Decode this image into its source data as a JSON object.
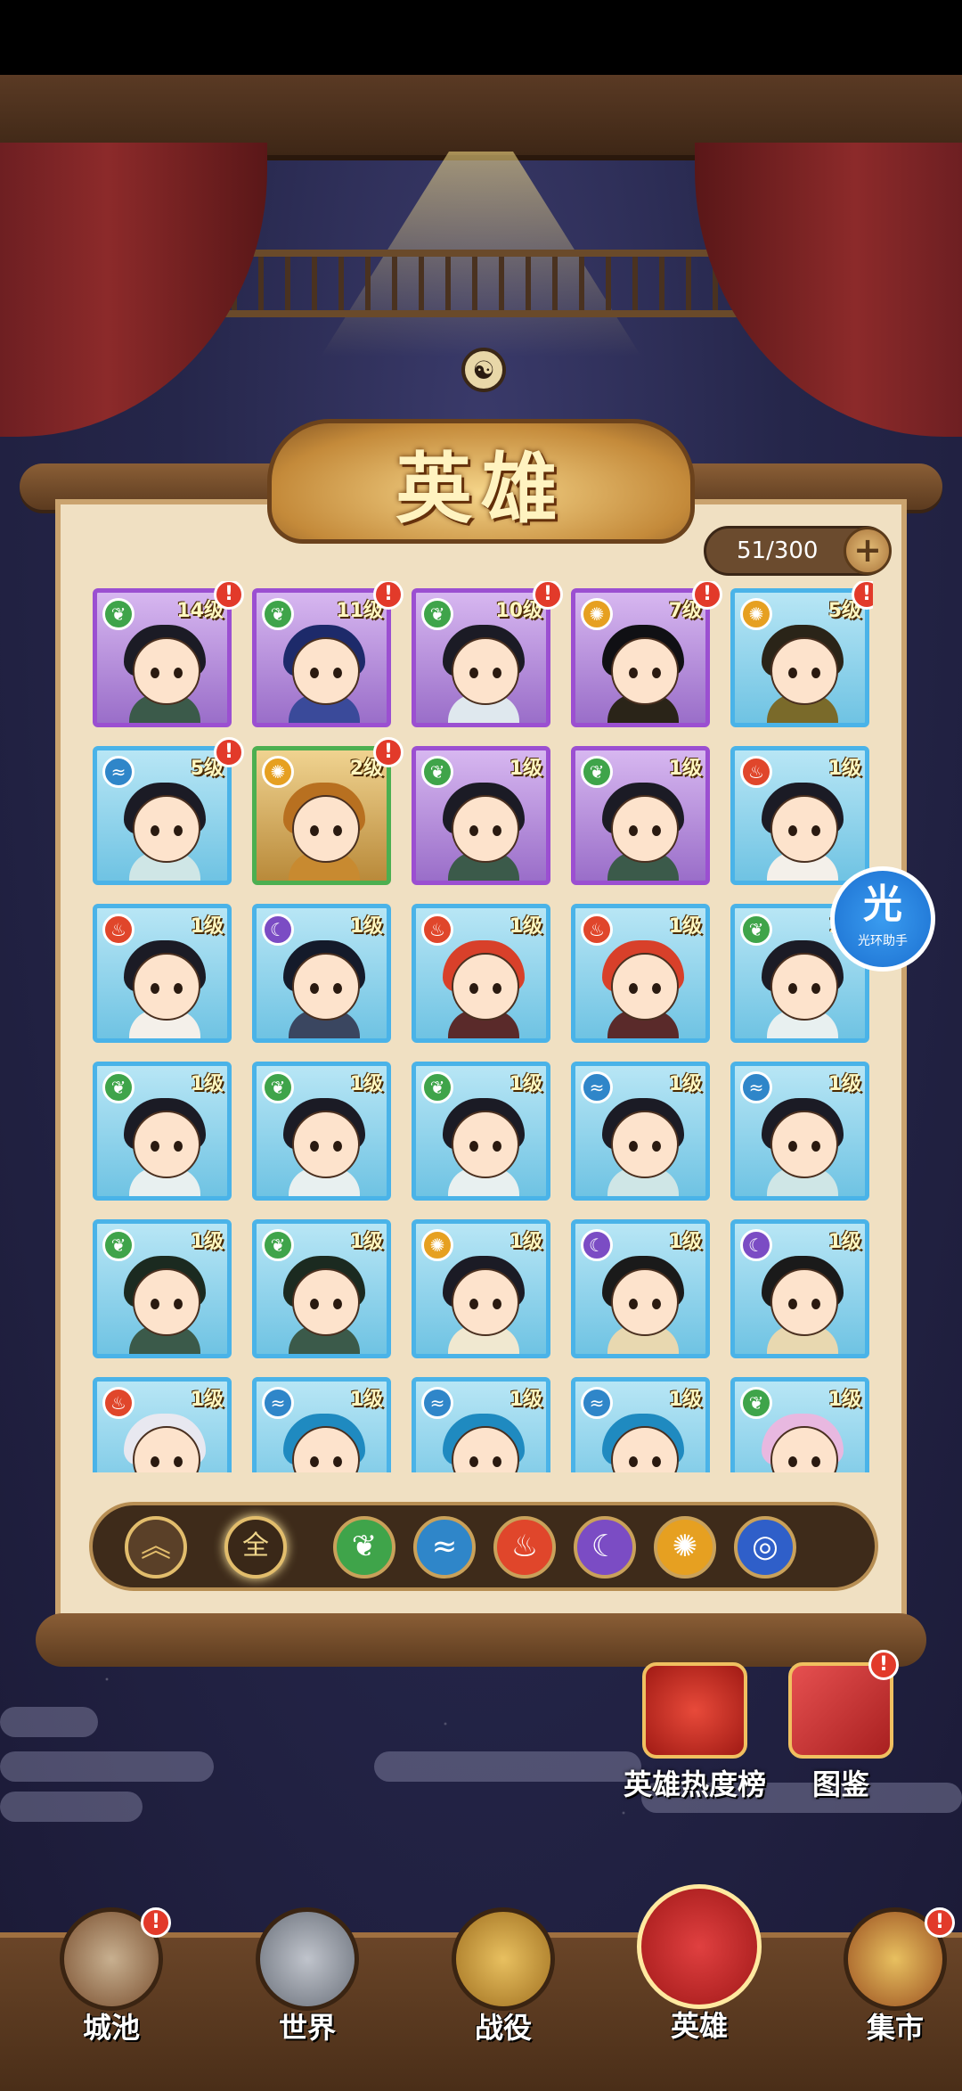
{
  "title": "英雄",
  "hero_count": "51/300",
  "helper": {
    "big": "光",
    "small": "光环助手"
  },
  "element_colors": {
    "wood": "#3fa44a",
    "water": "#2f86c9",
    "fire": "#e0462b",
    "moon": "#7b4cc4",
    "light": "#e6a021",
    "storm": "#2f5fc9"
  },
  "heroes": [
    {
      "level": "14级",
      "element": "wood",
      "rarity": "purple",
      "alert": true,
      "hair": "#1b1b25",
      "outfit": "#3b5a4a"
    },
    {
      "level": "11级",
      "element": "wood",
      "rarity": "purple",
      "alert": true,
      "hair": "#1d2a6a",
      "outfit": "#3a4a9a"
    },
    {
      "level": "10级",
      "element": "wood",
      "rarity": "purple",
      "alert": true,
      "hair": "#1b1b25",
      "outfit": "#dfe8ee"
    },
    {
      "level": "7级",
      "element": "light",
      "rarity": "purple",
      "alert": true,
      "hair": "#101014",
      "outfit": "#2a2418"
    },
    {
      "level": "5级",
      "element": "light",
      "rarity": "blue",
      "alert": true,
      "hair": "#2a2418",
      "outfit": "#7a6a2a"
    },
    {
      "level": "5级",
      "element": "water",
      "rarity": "blue",
      "alert": true,
      "hair": "#1b1b25",
      "outfit": "#cfe6e6"
    },
    {
      "level": "2级",
      "element": "light",
      "rarity": "green",
      "alert": true,
      "hair": "#b87020",
      "outfit": "#c88a30"
    },
    {
      "level": "1级",
      "element": "wood",
      "rarity": "purple",
      "alert": false,
      "hair": "#1b1b25",
      "outfit": "#3b5a4a"
    },
    {
      "level": "1级",
      "element": "wood",
      "rarity": "purple",
      "alert": false,
      "hair": "#1b1b25",
      "outfit": "#3b5a4a"
    },
    {
      "level": "1级",
      "element": "fire",
      "rarity": "blue",
      "alert": false,
      "hair": "#1b1b25",
      "outfit": "#f4f0ea"
    },
    {
      "level": "1级",
      "element": "fire",
      "rarity": "blue",
      "alert": false,
      "hair": "#1b1b25",
      "outfit": "#f4f0ea"
    },
    {
      "level": "1级",
      "element": "moon",
      "rarity": "blue",
      "alert": false,
      "hair": "#141a2a",
      "outfit": "#3a4660"
    },
    {
      "level": "1级",
      "element": "fire",
      "rarity": "blue",
      "alert": false,
      "hair": "#d8402a",
      "outfit": "#5a2a2a"
    },
    {
      "level": "1级",
      "element": "fire",
      "rarity": "blue",
      "alert": false,
      "hair": "#d8402a",
      "outfit": "#5a2a2a"
    },
    {
      "level": "1级",
      "element": "wood",
      "rarity": "blue",
      "alert": false,
      "hair": "#1b1b25",
      "outfit": "#e8f0f0"
    },
    {
      "level": "1级",
      "element": "wood",
      "rarity": "blue",
      "alert": false,
      "hair": "#1b1b25",
      "outfit": "#e8f0f0"
    },
    {
      "level": "1级",
      "element": "wood",
      "rarity": "blue",
      "alert": false,
      "hair": "#1b1b25",
      "outfit": "#e8f0f0"
    },
    {
      "level": "1级",
      "element": "wood",
      "rarity": "blue",
      "alert": false,
      "hair": "#1b1b25",
      "outfit": "#e8f0f0"
    },
    {
      "level": "1级",
      "element": "water",
      "rarity": "blue",
      "alert": false,
      "hair": "#1b1b25",
      "outfit": "#cfe6e6"
    },
    {
      "level": "1级",
      "element": "water",
      "rarity": "blue",
      "alert": false,
      "hair": "#1b1b25",
      "outfit": "#cfe6e6"
    },
    {
      "level": "1级",
      "element": "wood",
      "rarity": "blue",
      "alert": false,
      "hair": "#1b2a20",
      "outfit": "#3b5a4a"
    },
    {
      "level": "1级",
      "element": "wood",
      "rarity": "blue",
      "alert": false,
      "hair": "#1b2a20",
      "outfit": "#3b5a4a"
    },
    {
      "level": "1级",
      "element": "light",
      "rarity": "blue",
      "alert": false,
      "hair": "#1b1b25",
      "outfit": "#f0e8d0"
    },
    {
      "level": "1级",
      "element": "moon",
      "rarity": "blue",
      "alert": false,
      "hair": "#1a1a1a",
      "outfit": "#e8d8b0"
    },
    {
      "level": "1级",
      "element": "moon",
      "rarity": "blue",
      "alert": false,
      "hair": "#1a1a1a",
      "outfit": "#e8d8b0"
    },
    {
      "level": "1级",
      "element": "fire",
      "rarity": "blue",
      "alert": false,
      "hair": "#e8e8f0",
      "outfit": "#2a2a3a"
    },
    {
      "level": "1级",
      "element": "water",
      "rarity": "blue",
      "alert": false,
      "hair": "#1f8ac0",
      "outfit": "#1f8ac0"
    },
    {
      "level": "1级",
      "element": "water",
      "rarity": "blue",
      "alert": false,
      "hair": "#1f8ac0",
      "outfit": "#1f8ac0"
    },
    {
      "level": "1级",
      "element": "water",
      "rarity": "blue",
      "alert": false,
      "hair": "#1f8ac0",
      "outfit": "#1f8ac0"
    },
    {
      "level": "1级",
      "element": "wood",
      "rarity": "blue",
      "alert": false,
      "hair": "#e8b8e0",
      "outfit": "#f0e0f0"
    }
  ],
  "filter": {
    "sort_icon": "double-chevron-up-icon",
    "all_label": "全",
    "elements": [
      "wood",
      "water",
      "fire",
      "moon",
      "light",
      "storm"
    ]
  },
  "shortcuts": [
    {
      "label": "英雄热度榜",
      "icon": "ranking-badge-icon",
      "alert": false
    },
    {
      "label": "图鉴",
      "icon": "book-icon",
      "alert": true
    }
  ],
  "nav": [
    {
      "label": "城池",
      "icon": "castle-icon",
      "alert": true,
      "active": false
    },
    {
      "label": "世界",
      "icon": "mountain-icon",
      "alert": false,
      "active": false
    },
    {
      "label": "战役",
      "icon": "crossed-swords-icon",
      "alert": false,
      "active": false
    },
    {
      "label": "英雄",
      "icon": "hero-portrait-icon",
      "alert": false,
      "active": true
    },
    {
      "label": "集市",
      "icon": "market-stall-icon",
      "alert": true,
      "active": false
    }
  ]
}
